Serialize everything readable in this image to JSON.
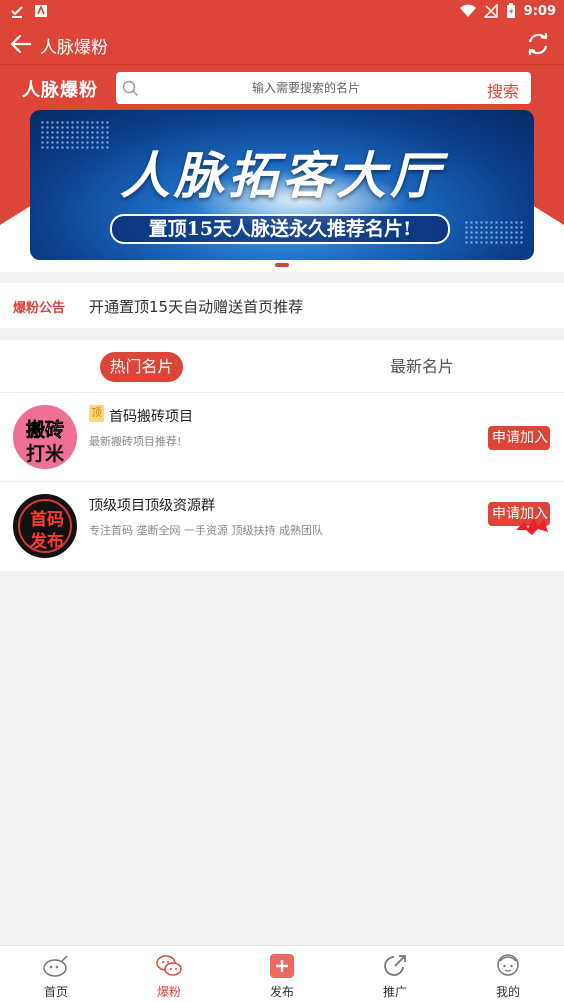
{
  "status_bar": {
    "time": "9:09"
  },
  "app_bar": {
    "title": "人脉爆粉"
  },
  "hero": {
    "brand": "人脉爆粉",
    "search_placeholder": "输入需要搜索的名片",
    "search_button": "搜索"
  },
  "banner": {
    "title": "人脉拓客大厅",
    "subtitle": "置顶15天人脉送永久推荐名片!"
  },
  "notice": {
    "label": "爆粉公告",
    "text": "开通置顶15天自动赠送首页推荐"
  },
  "tabs": [
    {
      "label": "热门名片",
      "active": true
    },
    {
      "label": "最新名片",
      "active": false
    }
  ],
  "cards": [
    {
      "avatar_line1": "搬砖",
      "avatar_line2": "打米",
      "top_badge": "顶",
      "name": "首码搬砖项目",
      "desc": "最新搬砖项目推荐!",
      "button": "申请加入"
    },
    {
      "avatar_line1": "首码",
      "avatar_line2": "发布",
      "name": "顶级项目顶级资源群",
      "desc": "专注首码 垄断全网 一手资源 顶级扶持 成熟团队",
      "button": "申请加入"
    }
  ],
  "bottom_nav": [
    {
      "label": "首页",
      "icon": "home-icon",
      "active": false
    },
    {
      "label": "爆粉",
      "icon": "wechat-icon",
      "active": true
    },
    {
      "label": "发布",
      "icon": "plus-icon",
      "active": false
    },
    {
      "label": "推广",
      "icon": "share-icon",
      "active": false
    },
    {
      "label": "我的",
      "icon": "profile-icon",
      "active": false
    }
  ],
  "colors": {
    "accent": "#dd4539"
  }
}
